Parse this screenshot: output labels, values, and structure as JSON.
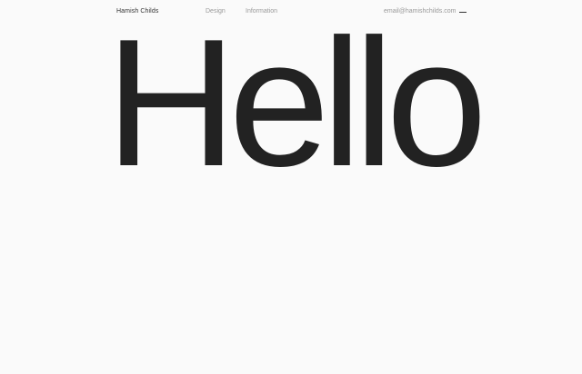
{
  "header": {
    "brand": "Hamish Childs",
    "nav": [
      {
        "label": "Design"
      },
      {
        "label": "Information"
      }
    ],
    "email": "email@hamishchilds.com",
    "menu_icon": "menu-icon"
  },
  "hero": {
    "heading": "Hello"
  },
  "colors": {
    "background": "#fafafa",
    "text": "#222222",
    "muted": "#9a9a9a"
  }
}
